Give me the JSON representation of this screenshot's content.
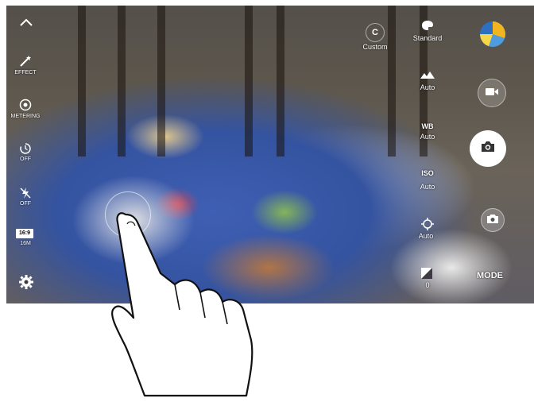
{
  "left_panel": {
    "collapse_icon": "chevron-up-icon",
    "effect_label": "EFFECT",
    "metering_label": "METERING",
    "timer_label": "OFF",
    "flash_label": "OFF",
    "ratio_badge": "16:9",
    "ratio_label": "16M",
    "settings_icon": "gear-icon"
  },
  "right_settings": {
    "custom_letter": "C",
    "custom_label": "Custom",
    "standard_label": "Standard",
    "iso_title": "ISO",
    "iso_value": "Auto",
    "wb_title": "WB",
    "wb_value": "Auto",
    "focus_value": "Auto",
    "shutter_speed_value": "Auto",
    "exposure_value": "0"
  },
  "buttons": {
    "mode_label": "MODE"
  },
  "colors": {
    "table": "#3453a0",
    "shutter": "#ffffff"
  }
}
